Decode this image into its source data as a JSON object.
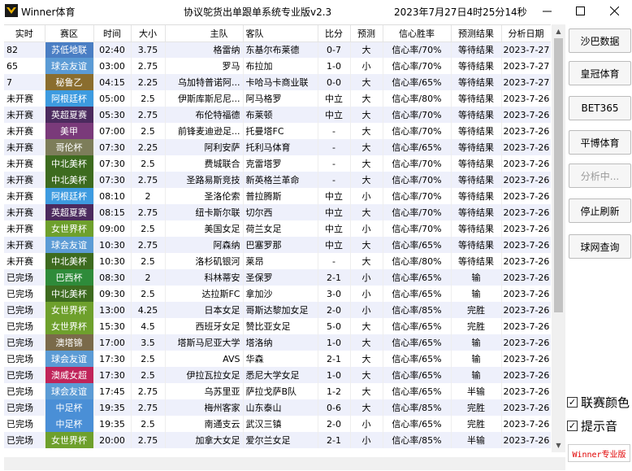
{
  "window": {
    "app_title": "Winner体育",
    "subtitle": "协议鸵货出单跟单系统专业版v2.3",
    "clock": "2023年7月27日4时25分14秒"
  },
  "table": {
    "headers": [
      "实时",
      "赛区",
      "时间",
      "大小",
      "主队",
      "客队",
      "比分",
      "预测",
      "信心胜率",
      "预测结果",
      "分析日期"
    ],
    "rows": [
      {
        "status": "82",
        "league": "苏低地联",
        "league_color": "#4a7ec4",
        "time": "02:40",
        "line": "3.75",
        "home": "格雷纳",
        "away": "东基尔布莱德",
        "score": "0-7",
        "pick": "大",
        "conf": "信心率/70%",
        "result": "等待结果",
        "date": "2023-7-27"
      },
      {
        "status": "65",
        "league": "球会友谊",
        "league_color": "#5b9bd5",
        "time": "03:00",
        "line": "2.75",
        "home": "罗马",
        "away": "布拉加",
        "score": "1-0",
        "pick": "小",
        "conf": "信心率/70%",
        "result": "等待结果",
        "date": "2023-7-27"
      },
      {
        "status": "7",
        "league": "秘鲁乙",
        "league_color": "#8a6d2e",
        "time": "04:15",
        "line": "2.25",
        "home": "乌加特普诺阿...",
        "away": "卡哈马卡商业联",
        "score": "0-0",
        "pick": "大",
        "conf": "信心率/65%",
        "result": "等待结果",
        "date": "2023-7-27"
      },
      {
        "status": "未开赛",
        "league": "阿根廷杯",
        "league_color": "#3d9be0",
        "time": "05:00",
        "line": "2.5",
        "home": "伊斯库斯尼尼...",
        "away": "阿马格罗",
        "score": "中立",
        "pick": "大",
        "conf": "信心率/80%",
        "result": "等待结果",
        "date": "2023-7-26"
      },
      {
        "status": "未开赛",
        "league": "英超夏赛",
        "league_color": "#4b2a5e",
        "time": "05:30",
        "line": "2.75",
        "home": "布伦特福德",
        "away": "布莱顿",
        "score": "中立",
        "pick": "大",
        "conf": "信心率/70%",
        "result": "等待结果",
        "date": "2023-7-26"
      },
      {
        "status": "未开赛",
        "league": "美甲",
        "league_color": "#7a3a7a",
        "time": "07:00",
        "line": "2.5",
        "home": "前锋麦迪逊足...",
        "away": "托曼塔FC",
        "score": "-",
        "pick": "大",
        "conf": "信心率/70%",
        "result": "等待结果",
        "date": "2023-7-26"
      },
      {
        "status": "未开赛",
        "league": "哥伦杯",
        "league_color": "#7d7d5a",
        "time": "07:30",
        "line": "2.25",
        "home": "阿利安萨",
        "away": "托利马体育",
        "score": "-",
        "pick": "大",
        "conf": "信心率/65%",
        "result": "等待结果",
        "date": "2023-7-26"
      },
      {
        "status": "未开赛",
        "league": "中北美杯",
        "league_color": "#3d6b1f",
        "time": "07:30",
        "line": "2.5",
        "home": "费城联合",
        "away": "克雷塔罗",
        "score": "-",
        "pick": "大",
        "conf": "信心率/70%",
        "result": "等待结果",
        "date": "2023-7-26"
      },
      {
        "status": "未开赛",
        "league": "中北美杯",
        "league_color": "#3d6b1f",
        "time": "07:30",
        "line": "2.75",
        "home": "圣路易斯竞技",
        "away": "新英格兰革命",
        "score": "-",
        "pick": "大",
        "conf": "信心率/70%",
        "result": "等待结果",
        "date": "2023-7-26"
      },
      {
        "status": "未开赛",
        "league": "阿根廷杯",
        "league_color": "#3d9be0",
        "time": "08:10",
        "line": "2",
        "home": "圣洛伦索",
        "away": "普拉腾斯",
        "score": "中立",
        "pick": "小",
        "conf": "信心率/70%",
        "result": "等待结果",
        "date": "2023-7-26"
      },
      {
        "status": "未开赛",
        "league": "英超夏赛",
        "league_color": "#4b2a5e",
        "time": "08:15",
        "line": "2.75",
        "home": "纽卡斯尔联",
        "away": "切尔西",
        "score": "中立",
        "pick": "大",
        "conf": "信心率/70%",
        "result": "等待结果",
        "date": "2023-7-26"
      },
      {
        "status": "未开赛",
        "league": "女世界杯",
        "league_color": "#6ea02c",
        "time": "09:00",
        "line": "2.5",
        "home": "美国女足",
        "away": "荷兰女足",
        "score": "中立",
        "pick": "小",
        "conf": "信心率/70%",
        "result": "等待结果",
        "date": "2023-7-26"
      },
      {
        "status": "未开赛",
        "league": "球会友谊",
        "league_color": "#5b9bd5",
        "time": "10:30",
        "line": "2.75",
        "home": "阿森纳",
        "away": "巴塞罗那",
        "score": "中立",
        "pick": "大",
        "conf": "信心率/65%",
        "result": "等待结果",
        "date": "2023-7-26"
      },
      {
        "status": "未开赛",
        "league": "中北美杯",
        "league_color": "#3d6b1f",
        "time": "10:30",
        "line": "2.5",
        "home": "洛杉矶银河",
        "away": "莱昂",
        "score": "-",
        "pick": "大",
        "conf": "信心率/80%",
        "result": "等待结果",
        "date": "2023-7-26"
      },
      {
        "status": "已完场",
        "league": "巴西杯",
        "league_color": "#2e8b3a",
        "time": "08:30",
        "line": "2",
        "home": "科林蒂安",
        "away": "圣保罗",
        "score": "2-1",
        "pick": "小",
        "conf": "信心率/65%",
        "result": "输",
        "date": "2023-7-26"
      },
      {
        "status": "已完场",
        "league": "中北美杯",
        "league_color": "#3d6b1f",
        "time": "09:30",
        "line": "2.5",
        "home": "达拉斯FC",
        "away": "拿加沙",
        "score": "3-0",
        "pick": "小",
        "conf": "信心率/65%",
        "result": "输",
        "date": "2023-7-26"
      },
      {
        "status": "已完场",
        "league": "女世界杯",
        "league_color": "#6ea02c",
        "time": "13:00",
        "line": "4.25",
        "home": "日本女足",
        "away": "哥斯达黎加女足",
        "score": "2-0",
        "pick": "小",
        "conf": "信心率/85%",
        "result": "完胜",
        "date": "2023-7-26"
      },
      {
        "status": "已完场",
        "league": "女世界杯",
        "league_color": "#6ea02c",
        "time": "15:30",
        "line": "4.5",
        "home": "西班牙女足",
        "away": "赞比亚女足",
        "score": "5-0",
        "pick": "大",
        "conf": "信心率/65%",
        "result": "完胜",
        "date": "2023-7-26"
      },
      {
        "status": "已完场",
        "league": "澳塔锦",
        "league_color": "#7a6a4a",
        "time": "17:00",
        "line": "3.5",
        "home": "塔斯马尼亚大学",
        "away": "塔洛纳",
        "score": "1-0",
        "pick": "大",
        "conf": "信心率/65%",
        "result": "输",
        "date": "2023-7-26"
      },
      {
        "status": "已完场",
        "league": "球会友谊",
        "league_color": "#5b9bd5",
        "time": "17:30",
        "line": "2.5",
        "home": "AVS",
        "away": "华森",
        "score": "2-1",
        "pick": "大",
        "conf": "信心率/65%",
        "result": "输",
        "date": "2023-7-26"
      },
      {
        "status": "已完场",
        "league": "澳威女超",
        "league_color": "#c0245a",
        "time": "17:30",
        "line": "2.5",
        "home": "伊拉瓦拉女足",
        "away": "悉尼大学女足",
        "score": "1-0",
        "pick": "大",
        "conf": "信心率/65%",
        "result": "输",
        "date": "2023-7-26"
      },
      {
        "status": "已完场",
        "league": "球会友谊",
        "league_color": "#5b9bd5",
        "time": "17:45",
        "line": "2.75",
        "home": "乌苏里亚",
        "away": "萨拉戈萨B队",
        "score": "1-2",
        "pick": "大",
        "conf": "信心率/65%",
        "result": "半输",
        "date": "2023-7-26"
      },
      {
        "status": "已完场",
        "league": "中足杯",
        "league_color": "#4a8fd6",
        "time": "19:35",
        "line": "2.75",
        "home": "梅州客家",
        "away": "山东泰山",
        "score": "0-6",
        "pick": "大",
        "conf": "信心率/85%",
        "result": "完胜",
        "date": "2023-7-26"
      },
      {
        "status": "已完场",
        "league": "中足杯",
        "league_color": "#4a8fd6",
        "time": "19:35",
        "line": "2.5",
        "home": "南通支云",
        "away": "武汉三镇",
        "score": "2-0",
        "pick": "小",
        "conf": "信心率/65%",
        "result": "完胜",
        "date": "2023-7-26"
      },
      {
        "status": "已完场",
        "league": "女世界杯",
        "league_color": "#6ea02c",
        "time": "20:00",
        "line": "2.75",
        "home": "加拿大女足",
        "away": "爱尔兰女足",
        "score": "2-1",
        "pick": "小",
        "conf": "信心率/85%",
        "result": "半输",
        "date": "2023-7-26"
      }
    ]
  },
  "sidebar": {
    "buttons": [
      {
        "label": "沙巴数据",
        "disabled": false
      },
      {
        "label": "皇冠体育",
        "disabled": false
      },
      {
        "label": "BET365",
        "disabled": false
      },
      {
        "label": "平博体育",
        "disabled": false
      },
      {
        "label": "分析中...",
        "disabled": true
      },
      {
        "label": "停止刷新",
        "disabled": false
      },
      {
        "label": "球网查询",
        "disabled": false
      }
    ],
    "checkboxes": [
      {
        "label": "联赛颜色",
        "checked": true
      },
      {
        "label": "提示音",
        "checked": true
      }
    ],
    "promo": "Winner专业版"
  }
}
